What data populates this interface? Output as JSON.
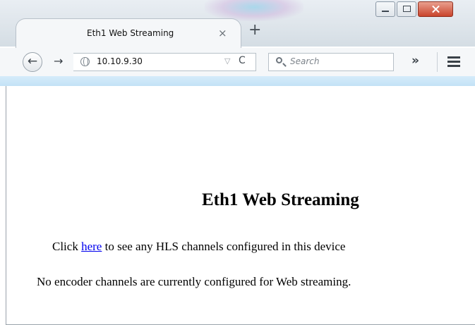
{
  "browser": {
    "tab_title": "Eth1 Web Streaming",
    "tab_close_glyph": "×",
    "new_tab_glyph": "+",
    "back_glyph": "←",
    "forward_glyph": "→",
    "url": "10.10.9.30",
    "url_dropdown_glyph": "▽",
    "reload_glyph": "C",
    "search_placeholder": "Search",
    "overflow_glyph": "»",
    "icons": {
      "back": "back-arrow-icon",
      "forward": "forward-arrow-icon",
      "site": "globe-icon",
      "search": "search-icon",
      "menu": "hamburger-menu-icon"
    }
  },
  "page": {
    "heading": "Eth1 Web Streaming",
    "line1_before": "Click ",
    "line1_link": "here",
    "line1_after": " to see any HLS channels configured in this device",
    "line2": "No encoder channels are currently configured for Web streaming."
  },
  "colors": {
    "link": "#0000ee",
    "close_button": "#c9442c",
    "nav_accent": "#c3e2f6"
  }
}
